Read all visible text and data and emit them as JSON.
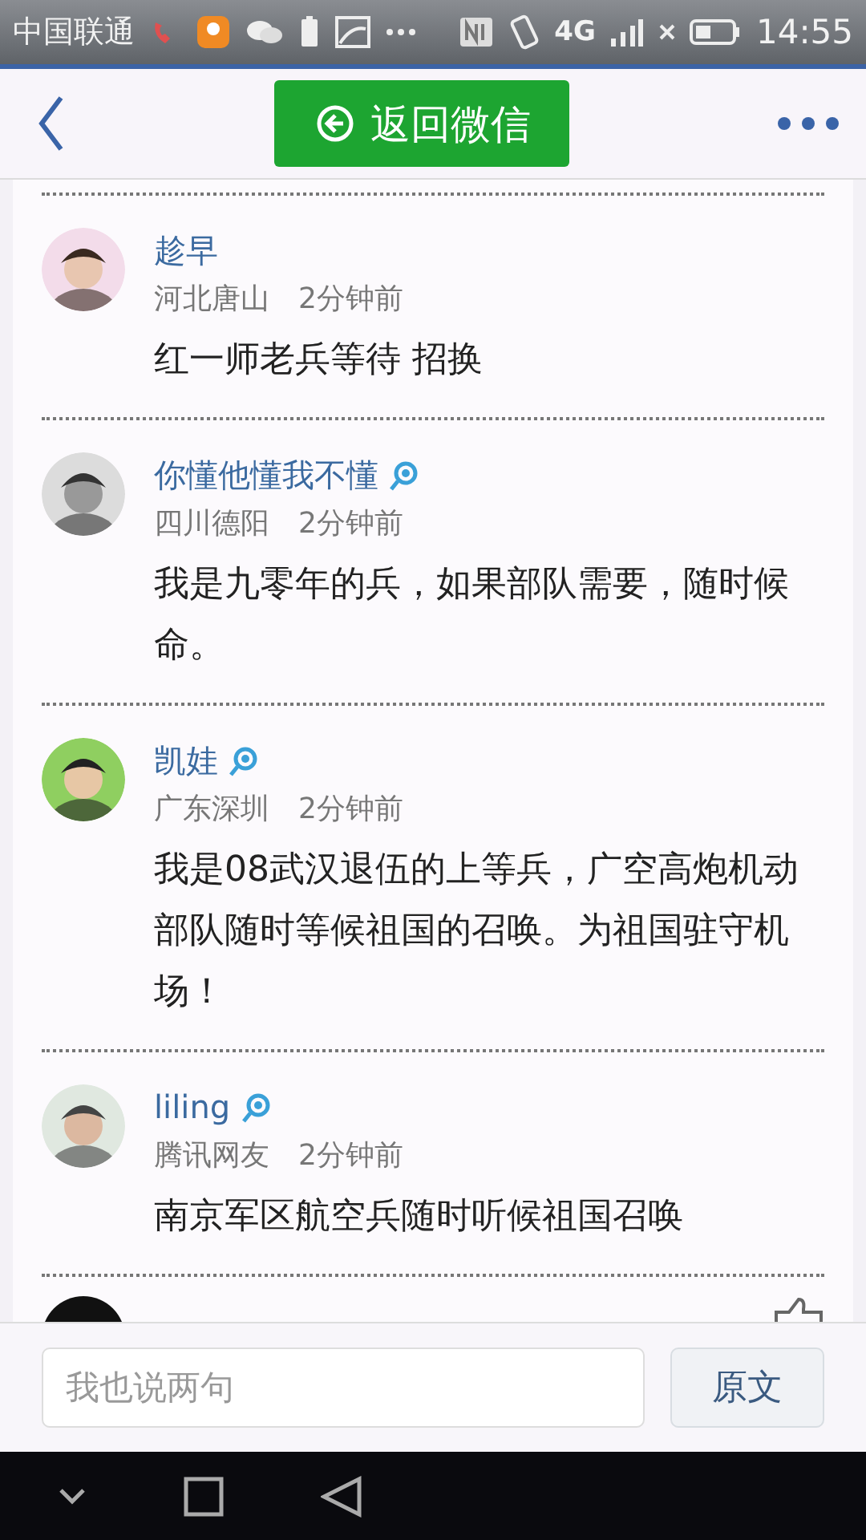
{
  "status_bar": {
    "carrier": "中国联通",
    "network": "4G",
    "time": "14:55"
  },
  "nav_bar": {
    "return_button": {
      "label": "返回微信"
    }
  },
  "comments": [
    {
      "name": "趁早",
      "verified": false,
      "location": "河北唐山",
      "time": "2分钟前",
      "text": "红一师老兵等待 招换"
    },
    {
      "name": "你懂他懂我不懂",
      "verified": true,
      "location": "四川德阳",
      "time": "2分钟前",
      "text": "我是九零年的兵，如果部队需要，随时候命。"
    },
    {
      "name": "凯娃",
      "verified": true,
      "location": "广东深圳",
      "time": "2分钟前",
      "text": "我是08武汉退伍的上等兵，广空高炮机动部队随时等候祖国的召唤。为祖国驻守机场！"
    },
    {
      "name": "liling",
      "verified": true,
      "location": "腾讯网友",
      "time": "2分钟前",
      "text": "南京军区航空兵随时听候祖国召唤"
    }
  ],
  "reply_bar": {
    "placeholder": "我也说两句",
    "button": "原文"
  }
}
